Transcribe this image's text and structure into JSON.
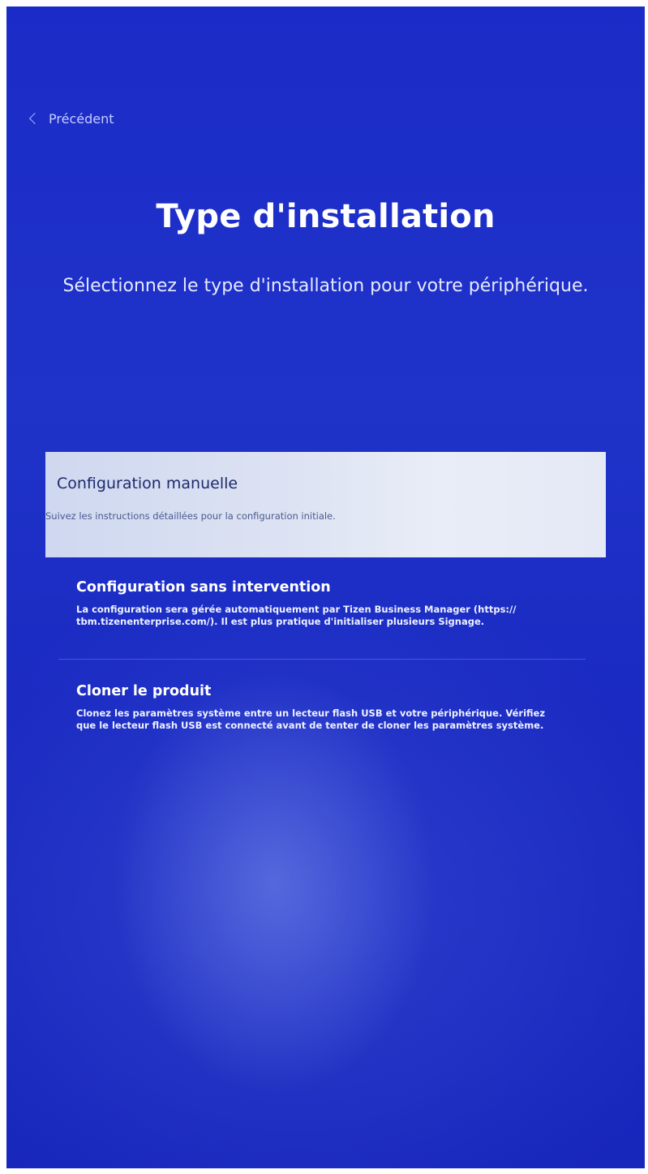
{
  "nav": {
    "back_label": "Précédent"
  },
  "header": {
    "title": "Type d'installation",
    "subtitle": "Sélectionnez le type d'installation pour votre périphérique."
  },
  "options": [
    {
      "title": "Configuration manuelle",
      "description": "Suivez les instructions détaillées pour la configuration initiale.",
      "selected": true
    },
    {
      "title": "Configuration sans intervention",
      "description_line1": "La configuration sera gérée automatiquement par Tizen Business Manager (https://",
      "description_line2": "tbm.tizenenterprise.com/). Il est plus pratique d'initialiser plusieurs Signage.",
      "selected": false
    },
    {
      "title": "Cloner le produit",
      "description_line1": "Clonez les paramètres système entre un lecteur flash USB et votre périphérique. Vérifiez",
      "description_line2": "que le lecteur flash USB est connecté avant de tenter de cloner les paramètres système.",
      "selected": false
    }
  ],
  "colors": {
    "background": "#1f33c9",
    "selected_bg": "#e4e9f5",
    "selected_text": "#1d2a6b",
    "text": "#ffffff"
  }
}
